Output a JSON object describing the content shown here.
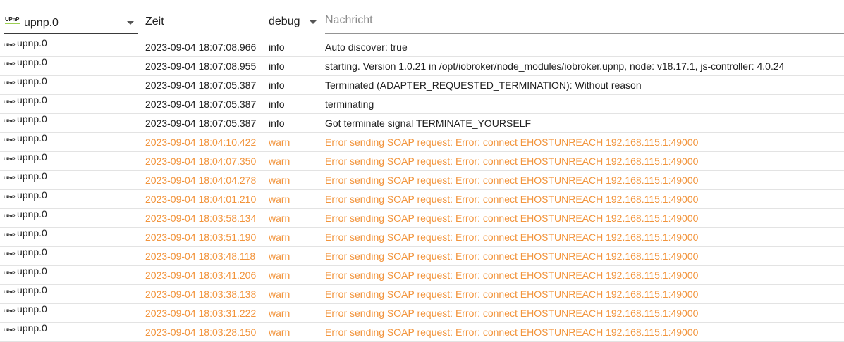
{
  "header": {
    "source_select": {
      "logo": "UPnP",
      "value": "upnp.0"
    },
    "time_header": "Zeit",
    "level_select": {
      "value": "debug"
    },
    "message_filter": {
      "placeholder": "Nachricht",
      "value": ""
    }
  },
  "row_icon": "UPnP",
  "colors": {
    "warn": "#f2943c",
    "info": "#212121"
  },
  "rows": [
    {
      "source": "upnp.0",
      "time": "2023-09-04 18:07:08.966",
      "level": "info",
      "message": "Auto discover: true"
    },
    {
      "source": "upnp.0",
      "time": "2023-09-04 18:07:08.955",
      "level": "info",
      "message": "starting. Version 1.0.21 in /opt/iobroker/node_modules/iobroker.upnp, node: v18.17.1, js-controller: 4.0.24"
    },
    {
      "source": "upnp.0",
      "time": "2023-09-04 18:07:05.387",
      "level": "info",
      "message": "Terminated (ADAPTER_REQUESTED_TERMINATION): Without reason"
    },
    {
      "source": "upnp.0",
      "time": "2023-09-04 18:07:05.387",
      "level": "info",
      "message": "terminating"
    },
    {
      "source": "upnp.0",
      "time": "2023-09-04 18:07:05.387",
      "level": "info",
      "message": "Got terminate signal TERMINATE_YOURSELF"
    },
    {
      "source": "upnp.0",
      "time": "2023-09-04 18:04:10.422",
      "level": "warn",
      "message": "Error sending SOAP request: Error: connect EHOSTUNREACH 192.168.115.1:49000"
    },
    {
      "source": "upnp.0",
      "time": "2023-09-04 18:04:07.350",
      "level": "warn",
      "message": "Error sending SOAP request: Error: connect EHOSTUNREACH 192.168.115.1:49000"
    },
    {
      "source": "upnp.0",
      "time": "2023-09-04 18:04:04.278",
      "level": "warn",
      "message": "Error sending SOAP request: Error: connect EHOSTUNREACH 192.168.115.1:49000"
    },
    {
      "source": "upnp.0",
      "time": "2023-09-04 18:04:01.210",
      "level": "warn",
      "message": "Error sending SOAP request: Error: connect EHOSTUNREACH 192.168.115.1:49000"
    },
    {
      "source": "upnp.0",
      "time": "2023-09-04 18:03:58.134",
      "level": "warn",
      "message": "Error sending SOAP request: Error: connect EHOSTUNREACH 192.168.115.1:49000"
    },
    {
      "source": "upnp.0",
      "time": "2023-09-04 18:03:51.190",
      "level": "warn",
      "message": "Error sending SOAP request: Error: connect EHOSTUNREACH 192.168.115.1:49000"
    },
    {
      "source": "upnp.0",
      "time": "2023-09-04 18:03:48.118",
      "level": "warn",
      "message": "Error sending SOAP request: Error: connect EHOSTUNREACH 192.168.115.1:49000"
    },
    {
      "source": "upnp.0",
      "time": "2023-09-04 18:03:41.206",
      "level": "warn",
      "message": "Error sending SOAP request: Error: connect EHOSTUNREACH 192.168.115.1:49000"
    },
    {
      "source": "upnp.0",
      "time": "2023-09-04 18:03:38.138",
      "level": "warn",
      "message": "Error sending SOAP request: Error: connect EHOSTUNREACH 192.168.115.1:49000"
    },
    {
      "source": "upnp.0",
      "time": "2023-09-04 18:03:31.222",
      "level": "warn",
      "message": "Error sending SOAP request: Error: connect EHOSTUNREACH 192.168.115.1:49000"
    },
    {
      "source": "upnp.0",
      "time": "2023-09-04 18:03:28.150",
      "level": "warn",
      "message": "Error sending SOAP request: Error: connect EHOSTUNREACH 192.168.115.1:49000"
    }
  ]
}
